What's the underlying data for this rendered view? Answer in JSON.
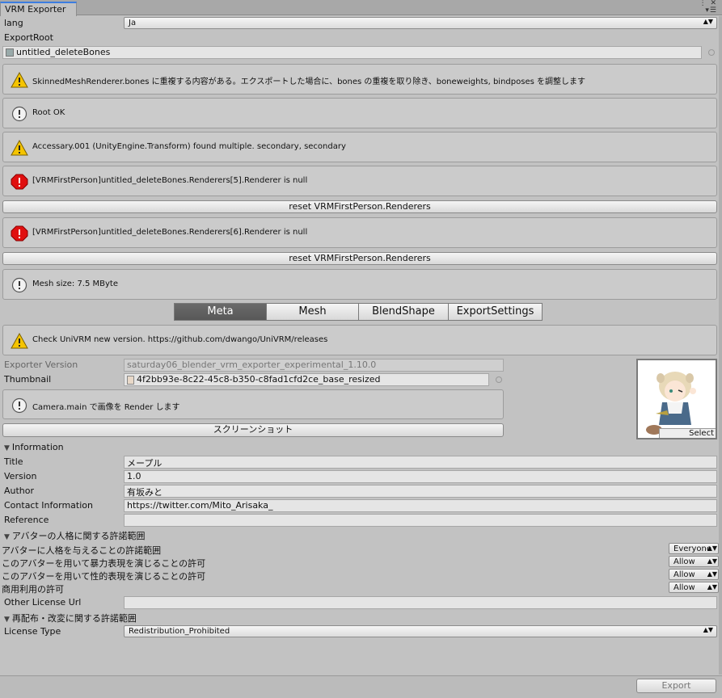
{
  "window": {
    "tab_title": "VRM Exporter",
    "buttons": "⋮ ✕\n▾☰"
  },
  "lang": {
    "label": "lang",
    "value": "Ja"
  },
  "export_root": {
    "label": "ExportRoot",
    "value": "untitled_deleteBones"
  },
  "messages": {
    "m1": "SkinnedMeshRenderer.bones に重複する内容がある。エクスポートした場合に、bones の重複を取り除き、boneweights, bindposes を調整します",
    "m2": "Root OK",
    "m3": "Accessary.001 (UnityEngine.Transform) found multiple. secondary, secondary",
    "m4": "[VRMFirstPerson]untitled_deleteBones.Renderers[5].Renderer is null",
    "m5": "[VRMFirstPerson]untitled_deleteBones.Renderers[6].Renderer is null",
    "m6": "Mesh size: 7.5 MByte",
    "m7": "Check UniVRM new version. https://github.com/dwango/UniVRM/releases",
    "m8": "Camera.main で画像を Render します"
  },
  "buttons": {
    "reset1": "reset VRMFirstPerson.Renderers",
    "reset2": "reset VRMFirstPerson.Renderers",
    "screenshot": "スクリーンショット",
    "select": "Select",
    "export": "Export"
  },
  "tabs": [
    {
      "label": "Meta",
      "active": true
    },
    {
      "label": "Mesh",
      "active": false
    },
    {
      "label": "BlendShape",
      "active": false
    },
    {
      "label": "ExportSettings",
      "active": false
    }
  ],
  "exporter_version": {
    "label": "Exporter Version",
    "value": "saturday06_blender_vrm_exporter_experimental_1.10.0"
  },
  "thumbnail": {
    "label": "Thumbnail",
    "value": "4f2bb93e-8c22-45c8-b350-c8fad1cfd2ce_base_resized"
  },
  "information": {
    "header": "Information",
    "title": {
      "label": "Title",
      "value": "メープル"
    },
    "version": {
      "label": "Version",
      "value": "1.0"
    },
    "author": {
      "label": "Author",
      "value": "有坂みと"
    },
    "contact": {
      "label": "Contact Information",
      "value": "https://twitter.com/Mito_Arisaka_"
    },
    "reference": {
      "label": "Reference",
      "value": ""
    }
  },
  "personality": {
    "header": "アバターの人格に関する許諾範囲",
    "allowed_user": {
      "label": "アバターに人格を与えることの許諾範囲",
      "value": "Everyone"
    },
    "violent": {
      "label": "このアバターを用いて暴力表現を演じることの許可",
      "value": "Allow"
    },
    "sexual": {
      "label": "このアバターを用いて性的表現を演じることの許可",
      "value": "Allow"
    },
    "commercial": {
      "label": "商用利用の許可",
      "value": "Allow"
    },
    "other_license": {
      "label": "Other License Url",
      "value": ""
    }
  },
  "redistribution": {
    "header": "再配布・改変に関する許諾範囲",
    "license_type": {
      "label": "License Type",
      "value": "Redistribution_Prohibited"
    }
  },
  "colors": {
    "accent": "#3c7de0",
    "warning": "#f5c400",
    "error": "#e01010",
    "tab_active": "#5e5e5e"
  }
}
